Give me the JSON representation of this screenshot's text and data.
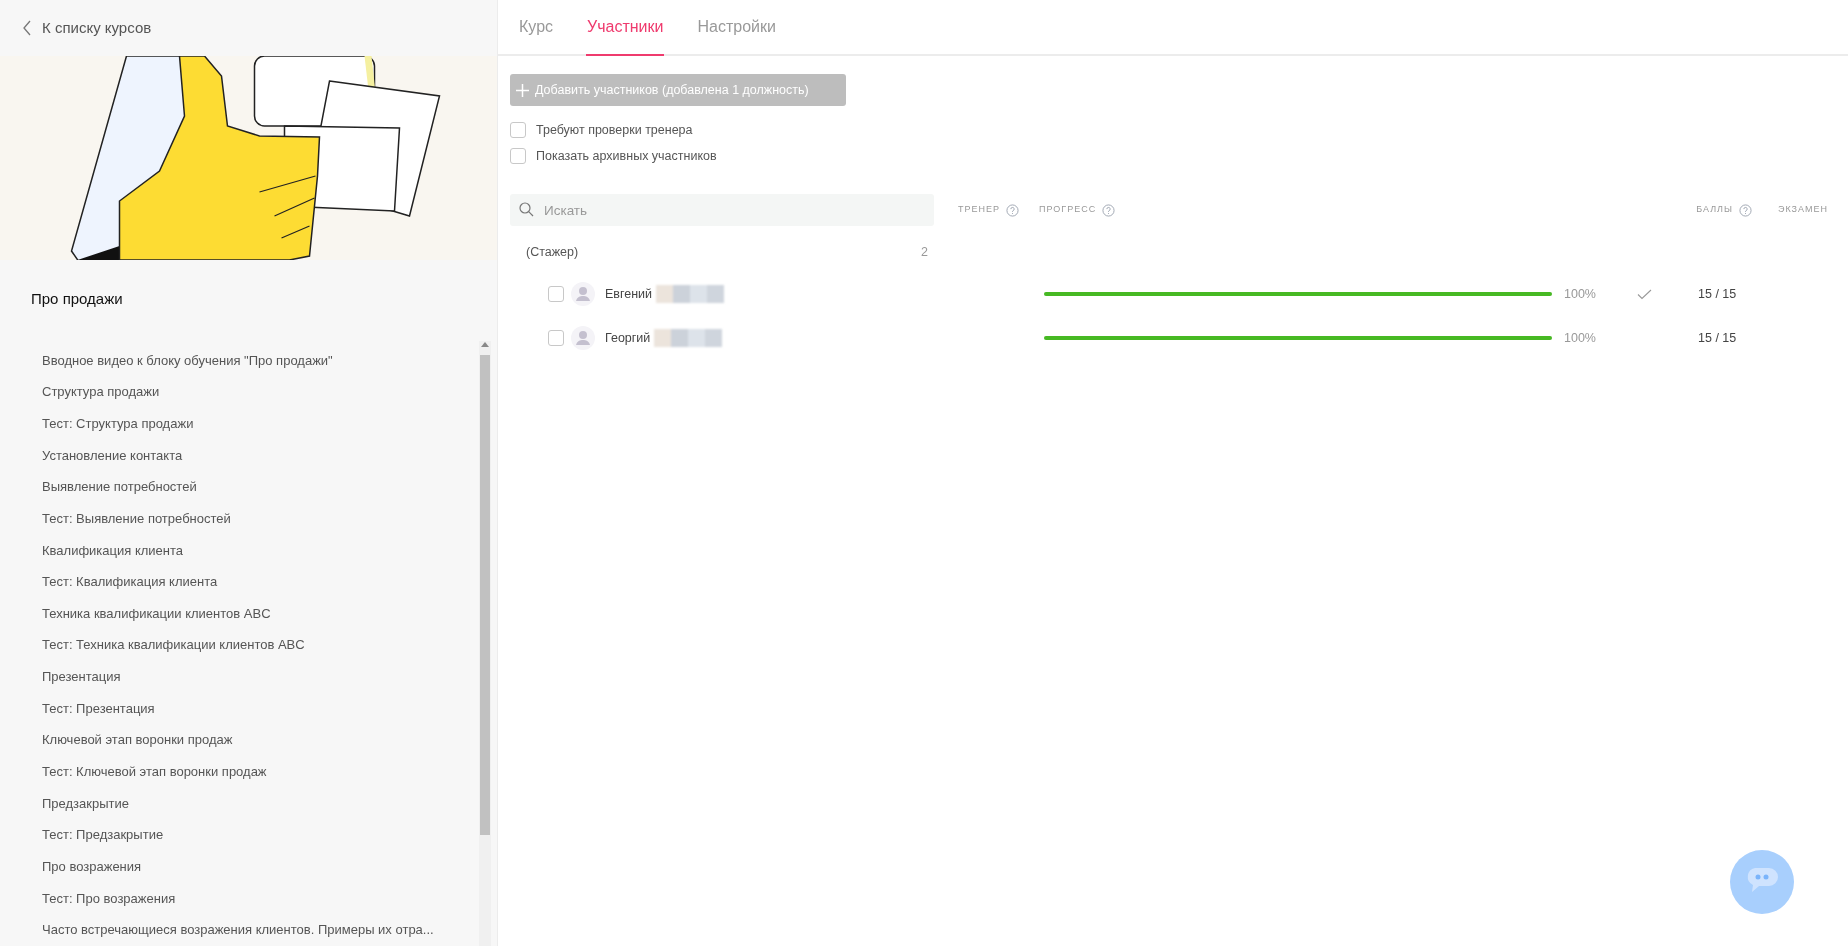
{
  "sidebar": {
    "back_link": "К списку курсов",
    "course_title": "Про продажи",
    "lessons": [
      "Вводное видео к блоку обучения \"Про продажи\"",
      "Структура продажи",
      "Тест: Структура продажи",
      "Установление контакта",
      "Выявление потребностей",
      "Тест: Выявление потребностей",
      "Квалификация клиента",
      "Тест: Квалификация клиента",
      "Техника квалификации клиентов ABC",
      "Тест: Техника квалификации клиентов ABC",
      "Презентация",
      "Тест: Презентация",
      "Ключевой этап воронки продаж",
      "Тест: Ключевой этап воронки продаж",
      "Предзакрытие",
      "Тест: Предзакрытие",
      "Про возражения",
      "Тест: Про возражения",
      "Часто встречающиеся возражения клиентов. Примеры их отра..."
    ]
  },
  "tabs": [
    {
      "label": "Курс",
      "selected": false
    },
    {
      "label": "Участники",
      "selected": true
    },
    {
      "label": "Настройки",
      "selected": false
    }
  ],
  "add_button": {
    "label": "Добавить участников (добавлена 1 должность)",
    "disabled": true
  },
  "filters": [
    {
      "label": "Требуют проверки тренера",
      "checked": false
    },
    {
      "label": "Показать архивных участников",
      "checked": false
    }
  ],
  "search": {
    "placeholder": "Искать"
  },
  "columns": [
    {
      "label": "ТРЕНЕР",
      "help": true
    },
    {
      "label": "ПРОГРЕСС",
      "help": true
    },
    {
      "label": "БАЛЛЫ",
      "help": true
    },
    {
      "label": "ЭКЗАМЕН",
      "help": false
    }
  ],
  "group": {
    "name": "(Стажер)",
    "count": "2"
  },
  "participants": [
    {
      "name": "Евгений",
      "checked": false,
      "level": 1.0,
      "progress": "100%",
      "exam_passed": true,
      "score": "15 / 15"
    },
    {
      "name": "Георгий",
      "checked": false,
      "level": 1.0,
      "progress": "100%",
      "exam_passed": false,
      "score": "15 / 15"
    }
  ]
}
